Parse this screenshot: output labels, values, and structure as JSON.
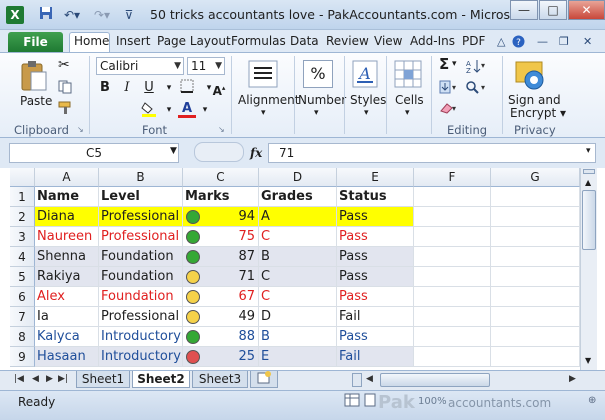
{
  "window": {
    "title": "50 tricks accountants love - PakAccountants.com  -  Microso",
    "app_icon": "X",
    "controls": [
      "—",
      "□",
      "✕"
    ]
  },
  "qat": {
    "save_icon": "save-icon",
    "undo_icon": "undo-icon",
    "redo_icon": "redo-icon",
    "customize": "customize-icon"
  },
  "tabs": {
    "file": "File",
    "items": [
      "Home",
      "Insert",
      "Page Layout",
      "Formulas",
      "Data",
      "Review",
      "View",
      "Add-Ins",
      "PDF"
    ],
    "active": "Home"
  },
  "ribbon": {
    "clipboard": {
      "paste": "Paste",
      "group": "Clipboard"
    },
    "font": {
      "name": "Calibri",
      "size": "11",
      "group": "Font",
      "bold": "B",
      "italic": "I",
      "underline": "U",
      "font_color": "A"
    },
    "alignment": {
      "label": "Alignment"
    },
    "number": {
      "label": "Number",
      "symbol": "%"
    },
    "styles": {
      "label": "Styles"
    },
    "cells": {
      "label": "Cells"
    },
    "editing": {
      "group": "Editing",
      "sum": "Σ"
    },
    "privacy": {
      "label1": "Sign and",
      "label2": "Encrypt",
      "group": "Privacy"
    }
  },
  "formula_bar": {
    "name_box": "C5",
    "fx": "fx",
    "content": "71"
  },
  "grid": {
    "columns": [
      "A",
      "B",
      "C",
      "D",
      "E",
      "F",
      "G"
    ],
    "row_numbers": [
      "1",
      "2",
      "3",
      "4",
      "5",
      "6",
      "7",
      "8",
      "9"
    ],
    "header": [
      "Name",
      "Level",
      "Marks",
      "Grades",
      "Status"
    ],
    "rows": [
      {
        "name": "Diana",
        "level": "Professional",
        "marks": "94",
        "grade": "A",
        "status": "Pass",
        "dot": "green",
        "color": "#1e1e1e",
        "bg": "#ffff00"
      },
      {
        "name": "Naureen",
        "level": "Professional",
        "marks": "75",
        "grade": "C",
        "status": "Pass",
        "dot": "green",
        "color": "#e02020",
        "bg": "#ffffff"
      },
      {
        "name": "Shenna",
        "level": "Foundation",
        "marks": "87",
        "grade": "B",
        "status": "Pass",
        "dot": "green",
        "color": "#1e1e1e",
        "bg": "#e2e5ef"
      },
      {
        "name": "Rakiya",
        "level": "Foundation",
        "marks": "71",
        "grade": "C",
        "status": "Pass",
        "dot": "yellow",
        "color": "#1e1e1e",
        "bg": "#e2e5ef"
      },
      {
        "name": "Alex",
        "level": "Foundation",
        "marks": "67",
        "grade": "C",
        "status": "Pass",
        "dot": "yellow",
        "color": "#e02020",
        "bg": "#ffffff"
      },
      {
        "name": "Ia",
        "level": "Professional",
        "marks": "49",
        "grade": "D",
        "status": "Fail",
        "dot": "yellow",
        "color": "#1e1e1e",
        "bg": "#ffffff"
      },
      {
        "name": "Kalyca",
        "level": "Introductory",
        "marks": "88",
        "grade": "B",
        "status": "Pass",
        "dot": "green",
        "color": "#1f4e9a",
        "bg": "#ffffff"
      },
      {
        "name": "Hasaan",
        "level": "Introductory",
        "marks": "25",
        "grade": "E",
        "status": "Fail",
        "dot": "red",
        "color": "#1f4e9a",
        "bg": "#e2e5ef"
      }
    ],
    "dot_colors": {
      "green": "#35a835",
      "yellow": "#f5d24a",
      "red": "#e05050"
    }
  },
  "sheets": {
    "tabs": [
      "Sheet1",
      "Sheet2",
      "Sheet3"
    ],
    "active": "Sheet2"
  },
  "status_bar": {
    "ready": "Ready",
    "zoom": "100%",
    "watermark": "accountants.com"
  }
}
